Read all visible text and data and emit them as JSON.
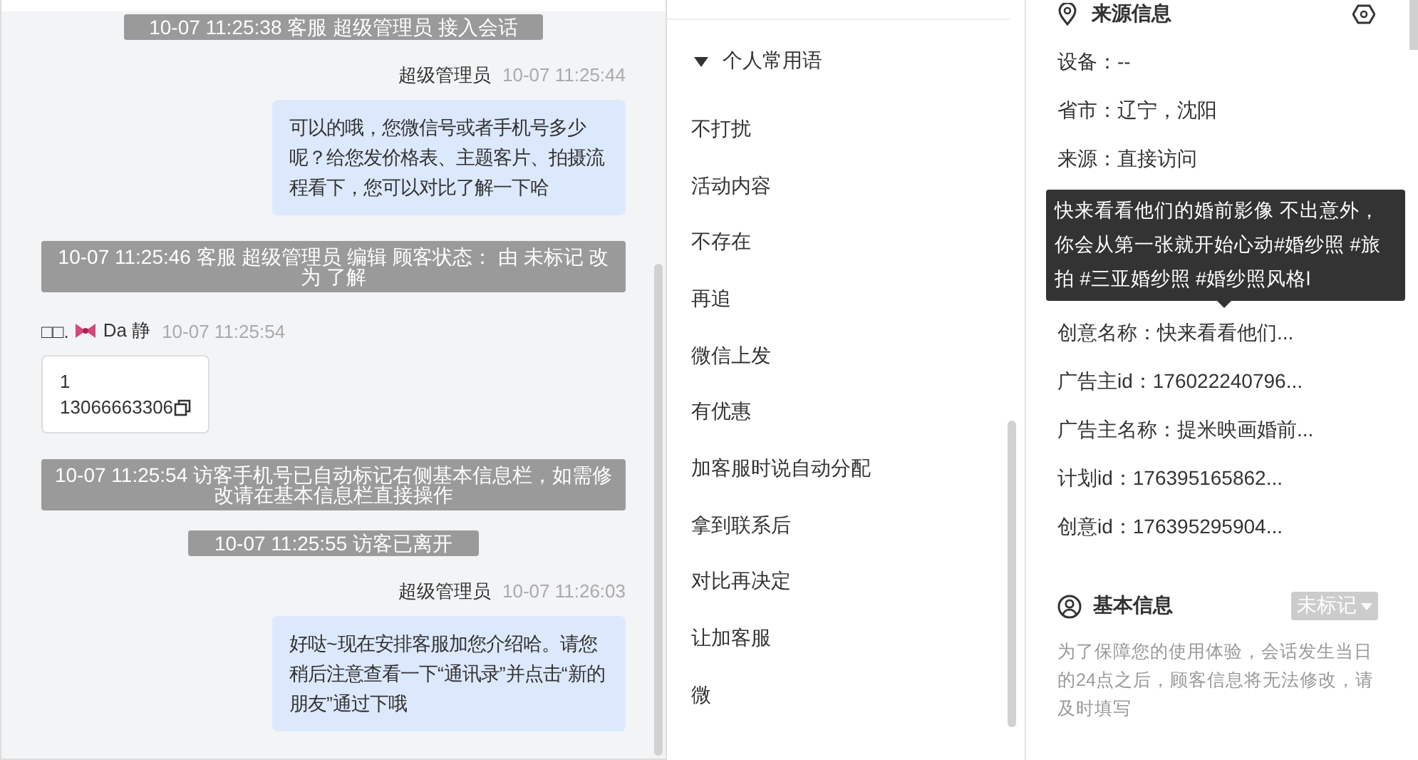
{
  "chat": {
    "messages": [
      {
        "kind": "system",
        "text": "10-07 11:25:38 客服 超级管理员 接入会话"
      },
      {
        "kind": "agent",
        "sender": "超级管理员",
        "time": "10-07 11:25:44",
        "text": "可以的哦，您微信号或者手机号多少呢？给您发价格表、主题客片、拍摄流程看下，您可以对比了解一下哈"
      },
      {
        "kind": "system",
        "text": "10-07 11:25:46 客服 超级管理员 编辑 顾客状态： 由 未标记 改为 了解"
      },
      {
        "kind": "visitor",
        "sender_prefix": "□□.",
        "sender": "Da 静",
        "time": "10-07 11:25:54",
        "lines": [
          "1",
          "13066663306"
        ]
      },
      {
        "kind": "system",
        "text": "10-07 11:25:54 访客手机号已自动标记右侧基本信息栏，如需修改请在基本信息栏直接操作"
      },
      {
        "kind": "system",
        "text": "10-07 11:25:55 访客已离开"
      },
      {
        "kind": "agent",
        "sender": "超级管理员",
        "time": "10-07 11:26:03",
        "text": "好哒~现在安排客服加您介绍哈。请您稍后注意查看一下“通讯录”并点击“新的朋友”通过下哦"
      }
    ]
  },
  "quick_replies": {
    "group": "个人常用语",
    "expanded": true,
    "items": [
      "不打扰",
      "活动内容",
      "不存在",
      "再追",
      "微信上发",
      "有优惠",
      "加客服时说自动分配",
      "拿到联系后",
      "对比再决定",
      "让加客服",
      "微"
    ]
  },
  "source_info": {
    "title": "来源信息",
    "fields_top": [
      "设备：--",
      "省市：辽宁，沈阳",
      "来源：直接访问"
    ],
    "tooltip": "快来看看他们的婚前影像 不出意外，你会从第一张就开始心动#婚纱照 #旅拍 #三亚婚纱照 #婚纱照风格l",
    "fields_bottom": [
      "创意名称：快来看看他们...",
      "广告主id：176022240796...",
      "广告主名称：提米映画婚前...",
      "计划id：176395165862...",
      "创意id：176395295904..."
    ]
  },
  "basic_info": {
    "title": "基本信息",
    "status": "未标记",
    "notice": "为了保障您的使用体验，会话发生当日的24点之后，顾客信息将无法修改，请及时填写"
  }
}
